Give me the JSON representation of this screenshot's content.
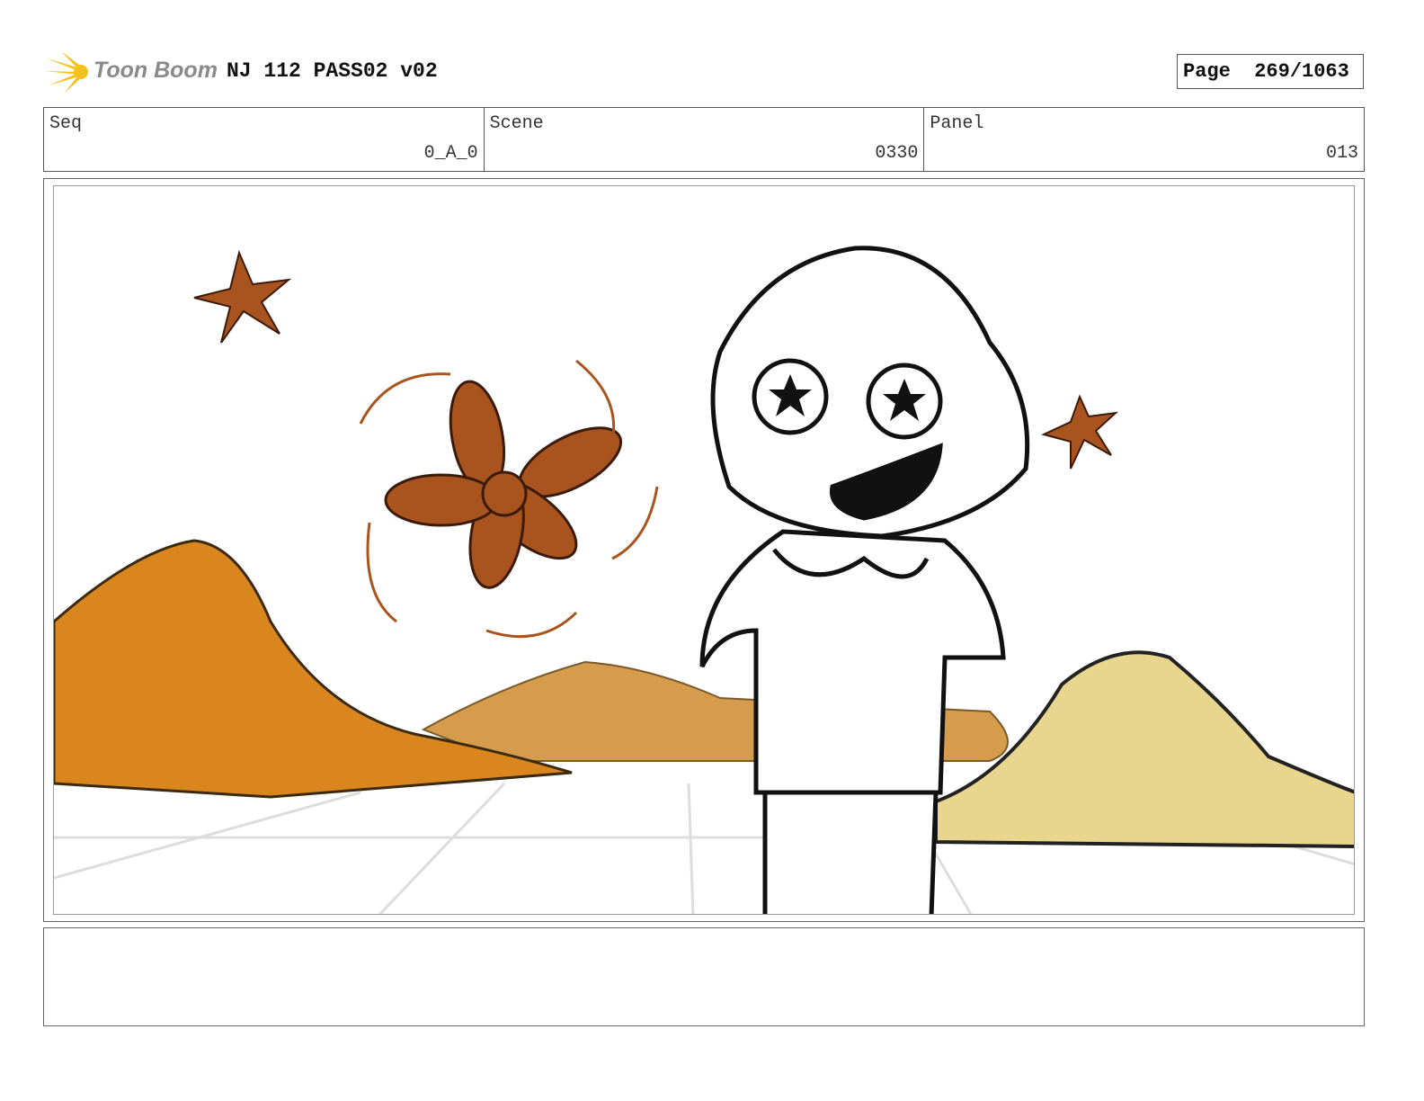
{
  "header": {
    "logo_text": "Toon Boom",
    "title": "NJ 112 PASS02 v02",
    "page_label": "Page",
    "page_value": "269/1063"
  },
  "info": [
    {
      "label": "Seq",
      "value": "0_A_0"
    },
    {
      "label": "Scene",
      "value": "0330"
    },
    {
      "label": "Panel",
      "value": "013"
    }
  ],
  "panel": {
    "colors": {
      "mountain_orange": "#d9861f",
      "mountain_tan": "#d49c4c",
      "mountain_yellow": "#e8d68e",
      "flower_brown": "#a9541f",
      "line": "#111111"
    },
    "notes": ""
  }
}
